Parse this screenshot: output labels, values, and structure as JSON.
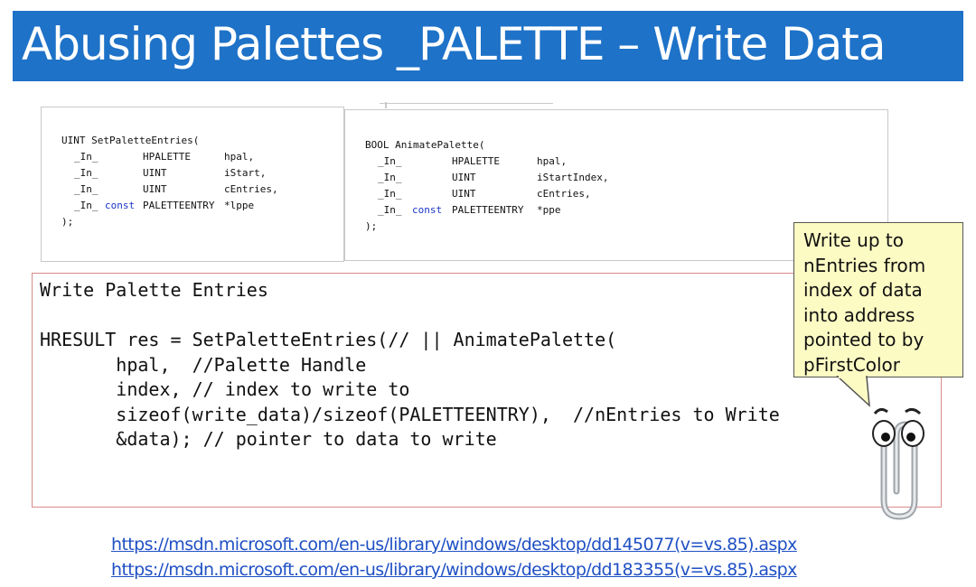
{
  "slide": {
    "title": "Abusing Palettes _PALETTE – Write Data"
  },
  "set_palette_entries_sig": {
    "header": "UINT SetPaletteEntries(",
    "rows": [
      {
        "prefix": "_In_",
        "kw": "",
        "type": "HPALETTE",
        "name": "hpal,"
      },
      {
        "prefix": "_In_",
        "kw": "",
        "type": "UINT",
        "name": "iStart,"
      },
      {
        "prefix": "_In_",
        "kw": "",
        "type": "UINT",
        "name": "cEntries,"
      },
      {
        "prefix": "_In_",
        "kw": "const",
        "type": "PALETTEENTRY",
        "name": "*lppe"
      }
    ],
    "footer": ");"
  },
  "animate_palette_sig": {
    "header": "BOOL AnimatePalette(",
    "rows": [
      {
        "prefix": "_In_",
        "kw": "",
        "type": "HPALETTE",
        "name": "hpal,"
      },
      {
        "prefix": "_In_",
        "kw": "",
        "type": "UINT",
        "name": "iStartIndex,"
      },
      {
        "prefix": "_In_",
        "kw": "",
        "type": "UINT",
        "name": "cEntries,"
      },
      {
        "prefix": "_In_",
        "kw": "const",
        "type": "PALETTEENTRY",
        "name": "*ppe"
      }
    ],
    "footer": ");"
  },
  "main_code": {
    "heading": "Write Palette Entries",
    "lines": [
      "HRESULT res = SetPaletteEntries(// || AnimatePalette(",
      "       hpal,  //Palette Handle",
      "       index, // index to write to",
      "       sizeof(write_data)/sizeof(PALETTEENTRY),  //nEntries to Write",
      "       &data); // pointer to data to write"
    ]
  },
  "callout": {
    "lines": [
      "Write up to",
      "nEntries from",
      "index of data",
      "into address",
      "pointed to by",
      "pFirstColor"
    ]
  },
  "links": [
    "https://msdn.microsoft.com/en-us/library/windows/desktop/dd145077(v=vs.85).aspx",
    "https://msdn.microsoft.com/en-us/library/windows/desktop/dd183355(v=vs.85).aspx"
  ],
  "colors": {
    "title_bar": "#1e72c8",
    "keyword": "#1a35c9",
    "callout_fill": "#fdfbc4",
    "link": "#1f50c4",
    "code_box_border": "#d98a8a"
  },
  "icons": [
    "clippy-paperclip-icon"
  ]
}
